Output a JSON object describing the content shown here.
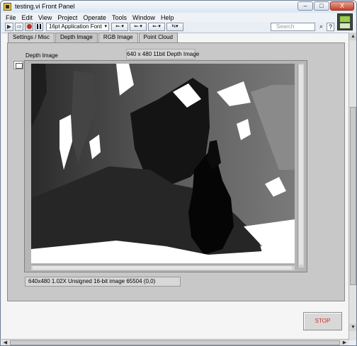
{
  "window": {
    "title": "testing.vi Front Panel",
    "minimize_label": "–",
    "maximize_label": "□",
    "close_label": "X"
  },
  "menu": {
    "items": [
      "File",
      "Edit",
      "View",
      "Project",
      "Operate",
      "Tools",
      "Window",
      "Help"
    ]
  },
  "toolbar": {
    "run_label": "▶",
    "run_continuous_label": "⇨",
    "abort_label": "●",
    "pause_label": "II",
    "font_value": "16pt Application Font",
    "align_label": "⇐·▾",
    "distribute_label": "⇐·▾",
    "resize_label": "⇐·▾",
    "reorder_label": "⇆▾",
    "search_placeholder": "Search",
    "search_icon": "search-icon",
    "help_icon": "help-icon",
    "help_label": "?"
  },
  "tabs": {
    "items": [
      "Settings / Misc",
      "Depth Image",
      "RGB Image",
      "Point Cloud"
    ],
    "active": "Depth Image"
  },
  "depth_panel": {
    "label": "Depth Image",
    "caption": "640 x 480 11bit Depth Image",
    "status_text": "640x480 1.02X Unsigned 16-bit image 65504    (0,0)"
  },
  "stop_button": {
    "label": "STOP",
    "color": "#d12a20"
  },
  "colors": {
    "chrome": "#e9eef5",
    "panel": "#c8c8c8",
    "accent_stop": "#d12a20"
  }
}
